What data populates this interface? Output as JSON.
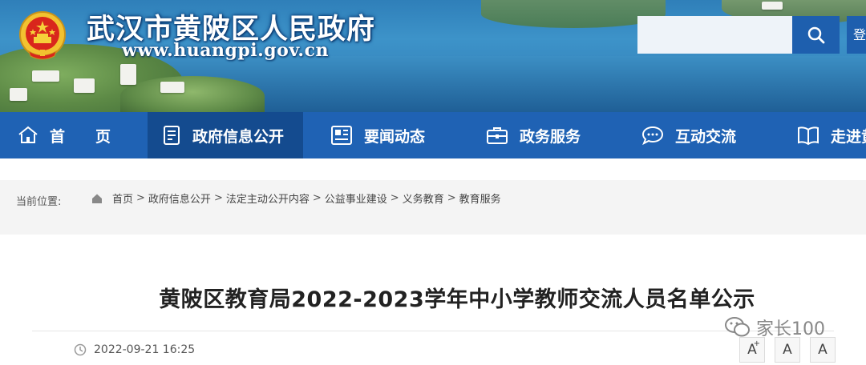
{
  "header": {
    "site_title": "武汉市黄陂区人民政府",
    "site_url": "www.huangpi.gov.cn",
    "search_placeholder": "",
    "login_label": "登"
  },
  "nav": {
    "items": [
      {
        "label": "首　　页",
        "icon": "home-icon"
      },
      {
        "label": "政府信息公开",
        "icon": "document-icon",
        "active": true
      },
      {
        "label": "要闻动态",
        "icon": "news-icon"
      },
      {
        "label": "政务服务",
        "icon": "briefcase-icon"
      },
      {
        "label": "互动交流",
        "icon": "chat-bubble-icon"
      },
      {
        "label": "走进黄",
        "icon": "book-icon"
      }
    ]
  },
  "breadcrumb": {
    "label": "当前位置:",
    "items": [
      "首页",
      "政府信息公开",
      "法定主动公开内容",
      "公益事业建设",
      "义务教育",
      "教育服务"
    ],
    "separator": ">"
  },
  "article": {
    "title": "黄陂区教育局2022-2023学年中小学教师交流人员名单公示",
    "date": "2022-09-21 16:25",
    "font_buttons": [
      "A",
      "A",
      "A"
    ],
    "font_button_sup": "+"
  },
  "watermark": {
    "text": "家长100"
  },
  "colors": {
    "nav_bg": "#1f62b4",
    "nav_active": "#144b8f",
    "search_btn": "#1e5fae"
  }
}
